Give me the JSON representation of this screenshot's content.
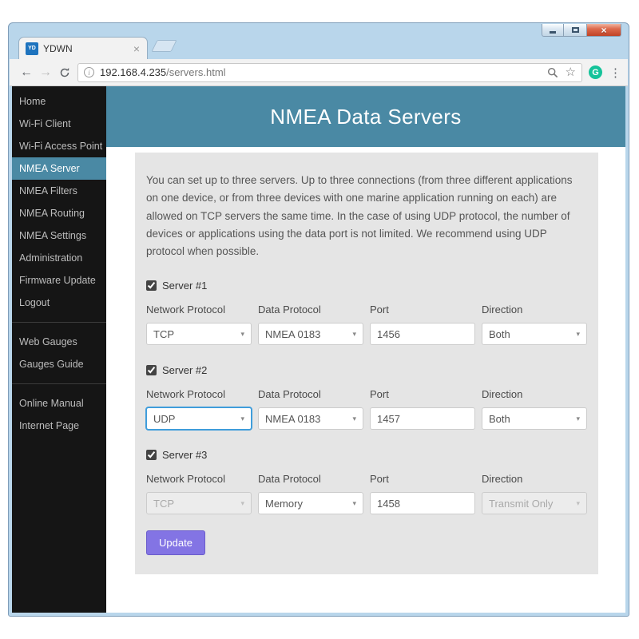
{
  "browser": {
    "tab_title": "YDWN",
    "favicon_text": "YD",
    "url_host": "192.168.4.235",
    "url_path": "/servers.html"
  },
  "icons": {
    "back": "←",
    "forward": "→",
    "window_close": "×",
    "tab_close": "×",
    "bookmark_star": "☆",
    "menu_dots": "⋮",
    "caret_down": "▾",
    "info": "i",
    "extension_letter": "G"
  },
  "sidebar": {
    "items": [
      {
        "label": "Home",
        "active": false
      },
      {
        "label": "Wi-Fi Client",
        "active": false
      },
      {
        "label": "Wi-Fi Access Point",
        "active": false
      },
      {
        "label": "NMEA Server",
        "active": true
      },
      {
        "label": "NMEA Filters",
        "active": false
      },
      {
        "label": "NMEA Routing",
        "active": false
      },
      {
        "label": "NMEA Settings",
        "active": false
      },
      {
        "label": "Administration",
        "active": false
      },
      {
        "label": "Firmware Update",
        "active": false
      },
      {
        "label": "Logout",
        "active": false
      },
      {
        "label": "Web Gauges",
        "active": false
      },
      {
        "label": "Gauges Guide",
        "active": false
      },
      {
        "label": "Online Manual",
        "active": false
      },
      {
        "label": "Internet Page",
        "active": false
      }
    ]
  },
  "page": {
    "title": "NMEA Data Servers",
    "intro": "You can set up to three servers. Up to three connections (from three different applications on one device, or from three devices with one marine application running on each) are allowed on TCP servers the same time. In the case of using UDP protocol, the number of devices or applications using the data port is not limited. We recommend using UDP protocol when possible.",
    "field_labels": {
      "network": "Network Protocol",
      "data": "Data Protocol",
      "port": "Port",
      "direction": "Direction"
    },
    "servers": [
      {
        "name": "Server #1",
        "checked": true,
        "network": "TCP",
        "data": "NMEA 0183",
        "port": "1456",
        "direction": "Both",
        "network_disabled": false,
        "network_focused": false,
        "direction_disabled": false
      },
      {
        "name": "Server #2",
        "checked": true,
        "network": "UDP",
        "data": "NMEA 0183",
        "port": "1457",
        "direction": "Both",
        "network_disabled": false,
        "network_focused": true,
        "direction_disabled": false
      },
      {
        "name": "Server #3",
        "checked": true,
        "network": "TCP",
        "data": "Memory",
        "port": "1458",
        "direction": "Transmit Only",
        "network_disabled": true,
        "network_focused": false,
        "direction_disabled": true
      }
    ],
    "update_label": "Update"
  },
  "colors": {
    "accent_teal": "#4a89a4",
    "button_purple": "#8374e4",
    "focus_blue": "#3f9ddb",
    "sidebar_bg": "#151515",
    "panel_bg": "#e5e5e5"
  }
}
